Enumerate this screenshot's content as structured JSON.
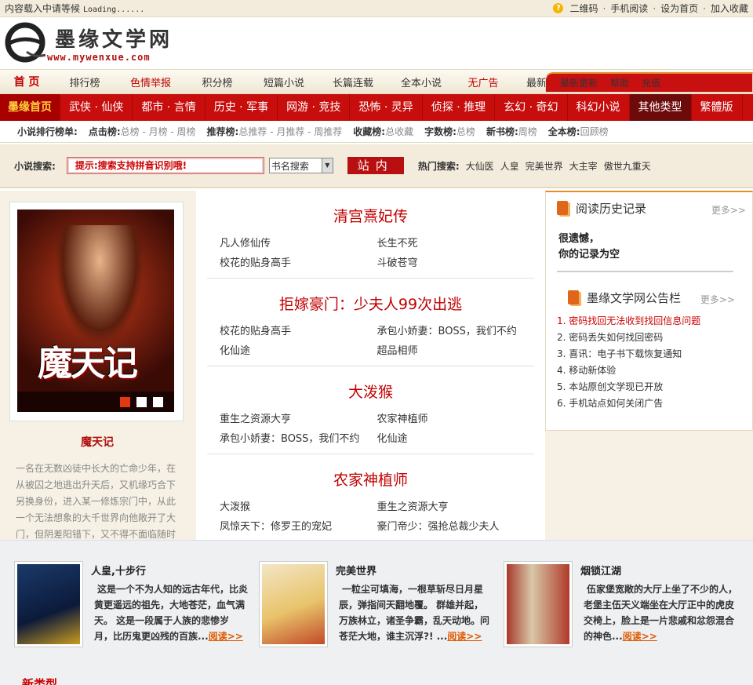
{
  "topbar": {
    "loading": "内容载入中请等候",
    "loading_mono": "Loading......",
    "qr": "二维码",
    "mobile": "手机阅读",
    "home": "设为首页",
    "fav": "加入收藏"
  },
  "header": {
    "logo_text": "墨缘文学网",
    "logo_url": "www.mywenxue.com"
  },
  "nav1": {
    "items": [
      "首 页",
      "排行榜",
      "色情举报",
      "积分榜",
      "短篇小说",
      "长篇连载",
      "全本小说",
      "无广告",
      "最新入库"
    ],
    "right": [
      "最新更新",
      "帮助",
      "充值"
    ]
  },
  "nav2": {
    "items": [
      "墨缘首页",
      "武侠 · 仙侠",
      "都市 · 言情",
      "历史 · 军事",
      "网游 · 竞技",
      "恐怖 · 灵异",
      "侦探 · 推理",
      "玄幻 · 奇幻",
      "科幻小说",
      "其他类型",
      "繁體版"
    ]
  },
  "ranks": {
    "title": "小说排行榜单:",
    "groups": [
      {
        "name": "点击榜:",
        "items": "总榜 - 月榜 - 周榜"
      },
      {
        "name": "推荐榜:",
        "items": "总推荐 - 月推荐 - 周推荐"
      },
      {
        "name": "收藏榜:",
        "items": "总收藏"
      },
      {
        "name": "字数榜:",
        "items": "总榜"
      },
      {
        "name": "新书榜:",
        "items": "周榜"
      },
      {
        "name": "全本榜:",
        "items": "回顾榜"
      }
    ]
  },
  "search": {
    "label": "小说搜索:",
    "placeholder": "提示:搜索支持拼音识别哦!",
    "select": "书名搜索",
    "button": "站内",
    "hot_label": "热门搜索:",
    "hot": [
      "大仙医",
      "人皇",
      "完美世界",
      "大主宰",
      "傲世九重天"
    ]
  },
  "feature": {
    "title": "魔天记",
    "cover_art": "魔天记",
    "desc": "一名在无数凶徒中长大的亡命少年，在从被囚之地逃出升天后，又机缘巧合下另换身份，进入某一修炼宗门中，从此一个无法想象的大千世界向他敞开了大门，但阴差阳错下，又不得不面临随时可能丧失性命，仙魔成采天魔的杀身之祸"
  },
  "center": {
    "blocks": [
      {
        "title": "清宫熹妃传",
        "links": [
          "凡人修仙传",
          "长生不死",
          "校花的贴身高手",
          "斗破苍穹"
        ]
      },
      {
        "title": "拒嫁豪门：少夫人99次出逃",
        "links": [
          "校花的贴身高手",
          "承包小娇妻：BOSS，我们不约",
          "化仙途",
          "超品相师"
        ]
      },
      {
        "title": "大泼猴",
        "links": [
          "重生之资源大亨",
          "农家神植师",
          "承包小娇妻：BOSS，我们不约",
          "化仙途"
        ]
      },
      {
        "title": "农家神植师",
        "links": [
          "大泼猴",
          "重生之资源大亨",
          "凤惊天下：修罗王的宠妃",
          "豪门帝少：强抢总裁少夫人"
        ]
      }
    ]
  },
  "history": {
    "title": "阅读历史记录",
    "more": "更多>>",
    "line1": "很遗憾，",
    "line2": "你的记录为空"
  },
  "notice": {
    "title": "墨缘文学网公告栏",
    "more": "更多>>",
    "items": [
      "1. 密码找回无法收到找回信息问题",
      "2. 密码丢失如何找回密码",
      "3. 喜讯：电子书下载恢复通知",
      "4. 移动新体验",
      "5. 本站原创文学现已开放",
      "6. 手机站点如何关闭广告"
    ]
  },
  "recommend": [
    {
      "name": "人皇,十步行",
      "text": "这是一个不为人知的远古年代，比炎黄更遥远的祖先，大地苍茫，血气满天。 这是一段属于人族的悲惨岁月，比历鬼更凶残的百族...",
      "read": "阅读>>"
    },
    {
      "name": "完美世界",
      "text": "一粒尘可填海，一根草斩尽日月星辰，弹指间天翻地覆。 群雄并起，万族林立，诸圣争霸，乱天动地。问苍茫大地，谁主沉浮?! ...",
      "read": "阅读>>"
    },
    {
      "name": "烟锁江湖",
      "text": "伍家堡宽敞的大厅上坐了不少的人，老堡主伍天义端坐在大厅正中的虎皮交椅上，脸上是一片悲戚和忿怨混合的神色...",
      "read": "阅读>>"
    }
  ],
  "newtype": "新类型"
}
